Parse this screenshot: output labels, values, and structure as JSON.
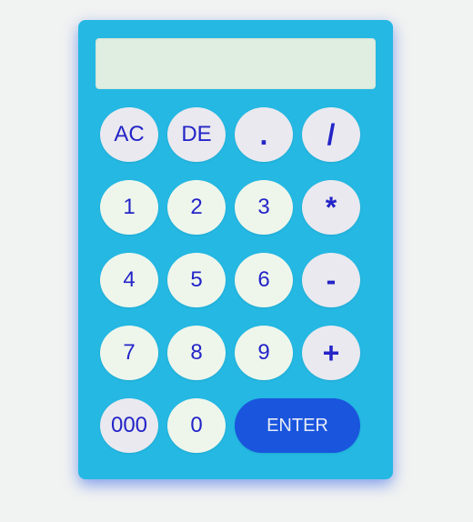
{
  "display": {
    "value": ""
  },
  "keys": {
    "clear": "AC",
    "delete": "DE",
    "decimal": ".",
    "divide": "/",
    "one": "1",
    "two": "2",
    "three": "3",
    "multiply": "*",
    "four": "4",
    "five": "5",
    "six": "6",
    "subtract": "-",
    "seven": "7",
    "eight": "8",
    "nine": "9",
    "add": "+",
    "triple_zero": "000",
    "zero": "0",
    "enter": "ENTER"
  },
  "colors": {
    "body": "#24b8e3",
    "display": "#dfeee1",
    "key": "#eef6ec",
    "key_gray": "#e9e9ef",
    "key_text": "#2424c8",
    "enter": "#1a55de"
  }
}
